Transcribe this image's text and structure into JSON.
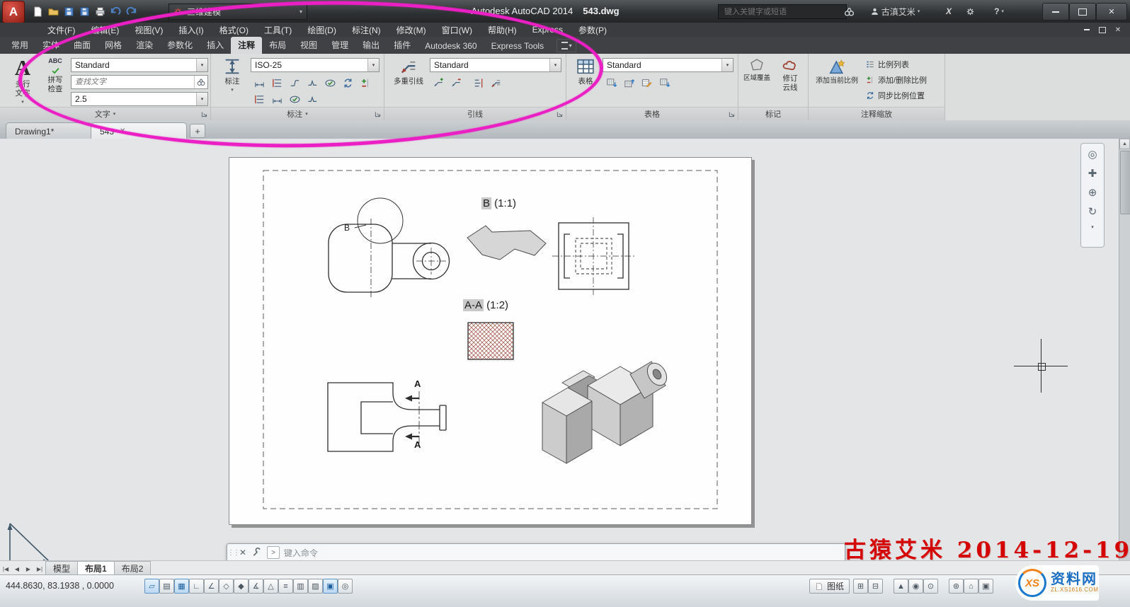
{
  "titlebar": {
    "workspace": "三维建模",
    "app_title": "Autodesk AutoCAD 2014",
    "doc_name": "543.dwg",
    "search_placeholder": "键入关键字或短语",
    "user": "古滇艾米",
    "exchange": "X",
    "help": "?"
  },
  "menubar": {
    "items": [
      "文件(F)",
      "编辑(E)",
      "视图(V)",
      "插入(I)",
      "格式(O)",
      "工具(T)",
      "绘图(D)",
      "标注(N)",
      "修改(M)",
      "窗口(W)",
      "帮助(H)",
      "Express",
      "参数(P)"
    ]
  },
  "ribbon": {
    "tabs": [
      "常用",
      "实体",
      "曲面",
      "网格",
      "渲染",
      "参数化",
      "插入",
      "注释",
      "布局",
      "视图",
      "管理",
      "输出",
      "插件",
      "Autodesk 360",
      "Express Tools"
    ],
    "text_panel": {
      "title": "文字",
      "a_glyph": "A",
      "mtext1": "多行",
      "mtext2": "文字",
      "abc": "ABC",
      "spell1": "拼写",
      "spell2": "检查",
      "style": "Standard",
      "find_placeholder": "查找文字",
      "height": "2.5"
    },
    "dim_panel": {
      "title": "标注",
      "big": "标注",
      "style": "ISO-25"
    },
    "leader_panel": {
      "title": "引线",
      "big": "多重引线",
      "style": "Standard"
    },
    "table_panel": {
      "title": "表格",
      "big": "表格",
      "style": "Standard"
    },
    "markup_panel": {
      "title": "标记",
      "wipeout": "区域覆盖",
      "rev1": "修订",
      "rev2": "云线"
    },
    "scale_panel": {
      "title": "注释缩放",
      "big": "添加当前比例",
      "item1": "比例列表",
      "item2": "添加/删除比例",
      "item3": "同步比例位置"
    }
  },
  "filetabs": {
    "tab1": "Drawing1*",
    "tab2": "543"
  },
  "drawing": {
    "detail_b": "B",
    "detail_b_scale": " (1:1)",
    "section_aa": "A-A",
    "section_aa_scale": " (1:2)",
    "callout_b": "B",
    "section_a1": "A",
    "section_a2": "A"
  },
  "command": {
    "prompt": "键入命令"
  },
  "layouts": {
    "model": "模型",
    "layout1": "布局1",
    "layout2": "布局2"
  },
  "statusbar": {
    "coords": "444.8630,  83.1938 ,  0.0000",
    "paper": "图纸",
    "left_icons": [
      "▱",
      "▤",
      "▦",
      "∟",
      "∠",
      "◇",
      "◆",
      "∡",
      "△",
      "≡",
      "▥",
      "▨",
      "▣",
      "◎"
    ],
    "right_icons": [
      "⊞",
      "⊟",
      "▲",
      "◉",
      "⊙",
      "⊛",
      "⌂",
      "▣"
    ]
  },
  "nav_icons": [
    "◎",
    "✚",
    "⊕",
    "↻"
  ],
  "watermark": {
    "text": "古猿艾米",
    "date": "2014-12-19"
  },
  "logo": {
    "xs": "XS",
    "name": "资料网",
    "site": "ZL.XS1616.COM"
  },
  "glyphs": {
    "caret": "▾",
    "close": "✕",
    "plus": "+",
    "prompt": "&gt;",
    "prompt_char": ">",
    "up": "▲",
    "down": "▼",
    "left_end": "|◀",
    "left": "◀",
    "right": "▶",
    "right_end": "▶|",
    "grip": "⋮⋮"
  }
}
